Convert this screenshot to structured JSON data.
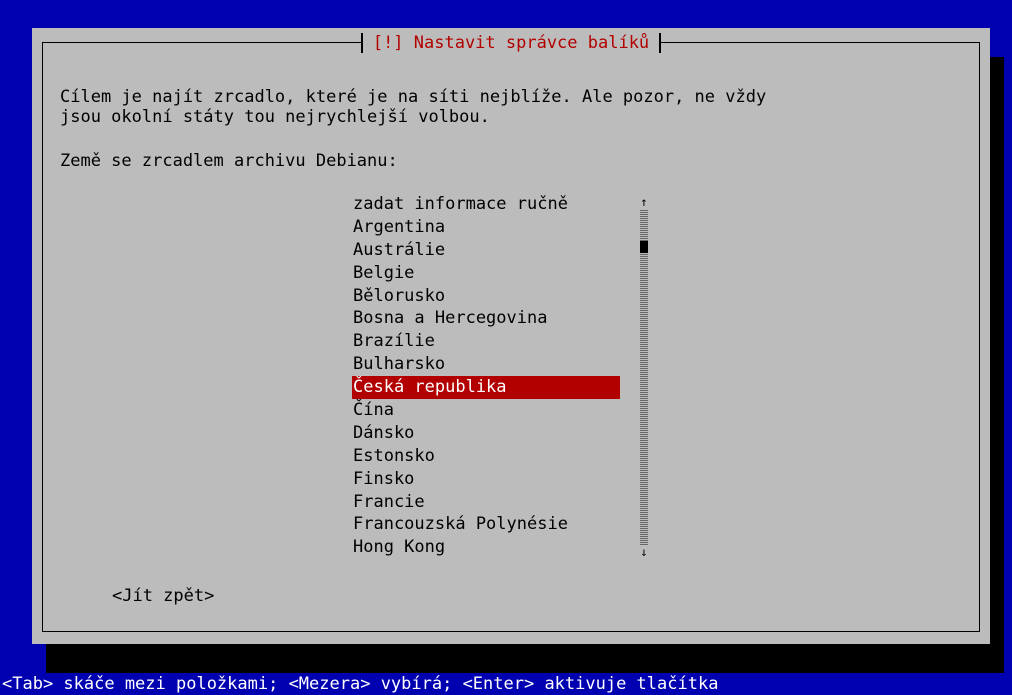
{
  "colors": {
    "background": "#0000b0",
    "dialog": "#bcbcbc",
    "accent": "#b20000",
    "text": "#000000",
    "hint_text": "#ffffff"
  },
  "dialog": {
    "title": "[!] Nastavit správce balíků",
    "description_line1": "Cílem je najít zrcadlo, které je na síti nejblíže. Ale pozor, ne vždy",
    "description_line2": "jsou okolní státy tou nejrychlejší volbou.",
    "prompt": "Země se zrcadlem archivu Debianu:",
    "items": [
      {
        "label": "zadat informace ručně",
        "selected": false
      },
      {
        "label": "Argentina",
        "selected": false
      },
      {
        "label": "Austrálie",
        "selected": false
      },
      {
        "label": "Belgie",
        "selected": false
      },
      {
        "label": "Bělorusko",
        "selected": false
      },
      {
        "label": "Bosna a Hercegovina",
        "selected": false
      },
      {
        "label": "Brazílie",
        "selected": false
      },
      {
        "label": "Bulharsko",
        "selected": false
      },
      {
        "label": "Česká republika",
        "selected": true
      },
      {
        "label": "Čína",
        "selected": false
      },
      {
        "label": "Dánsko",
        "selected": false
      },
      {
        "label": "Estonsko",
        "selected": false
      },
      {
        "label": "Finsko",
        "selected": false
      },
      {
        "label": "Francie",
        "selected": false
      },
      {
        "label": "Francouzská Polynésie",
        "selected": false
      },
      {
        "label": "Hong Kong",
        "selected": false
      }
    ],
    "scroll_up_icon": "arrow-up-icon",
    "scroll_down_icon": "arrow-down-icon",
    "back_button": "<Jít zpět>"
  },
  "footer": {
    "hint": "<Tab> skáče mezi položkami; <Mezera> vybírá; <Enter> aktivuje tlačítka"
  }
}
